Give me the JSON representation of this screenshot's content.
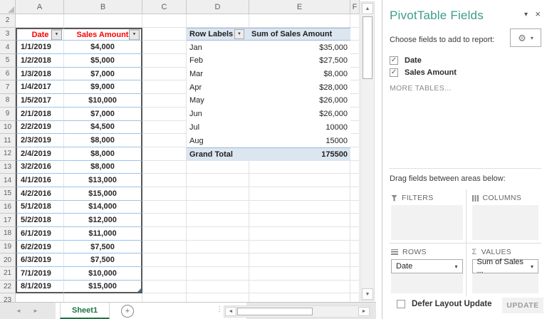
{
  "icons": {
    "chevron_down": "▾",
    "close": "×",
    "gear": "⚙",
    "filter_dropdown": "▼",
    "sort_dropdown": "▼",
    "sigma": "Σ",
    "nav_left": "◄",
    "nav_right": "►",
    "plus": "+",
    "dots": "⋮",
    "up": "▲",
    "down": "▼",
    "left": "◄",
    "right": "►",
    "check": "✓"
  },
  "colors": {
    "header_text_red": "#FE0000",
    "pivot_shade_blue": "#DCE6F1",
    "table_row_line_blue": "#9DC3E6",
    "sheet_tab_green": "#217346",
    "pane_title_teal": "#3E9B8B"
  },
  "sheet": {
    "tab_name": "Sheet1",
    "columns": [
      "A",
      "B",
      "C",
      "D",
      "E",
      "F"
    ],
    "row_numbers": [
      "2",
      "3",
      "4",
      "5",
      "6",
      "7",
      "8",
      "9",
      "10",
      "11",
      "12",
      "13",
      "14",
      "15",
      "16",
      "17",
      "18",
      "19",
      "20",
      "21",
      "22",
      "23"
    ],
    "table": {
      "headers": [
        "Date",
        "Sales Amount"
      ],
      "rows": [
        [
          "1/1/2019",
          "$4,000"
        ],
        [
          "1/2/2018",
          "$5,000"
        ],
        [
          "1/3/2018",
          "$7,000"
        ],
        [
          "1/4/2017",
          "$9,000"
        ],
        [
          "1/5/2017",
          "$10,000"
        ],
        [
          "2/1/2018",
          "$7,000"
        ],
        [
          "2/2/2019",
          "$4,500"
        ],
        [
          "2/3/2019",
          "$8,000"
        ],
        [
          "2/4/2019",
          "$8,000"
        ],
        [
          "3/2/2016",
          "$8,000"
        ],
        [
          "4/1/2016",
          "$13,000"
        ],
        [
          "4/2/2016",
          "$15,000"
        ],
        [
          "5/1/2018",
          "$14,000"
        ],
        [
          "5/2/2018",
          "$12,000"
        ],
        [
          "6/1/2019",
          "$11,000"
        ],
        [
          "6/2/2019",
          "$7,500"
        ],
        [
          "6/3/2019",
          "$7,500"
        ],
        [
          "7/1/2019",
          "$10,000"
        ],
        [
          "8/1/2019",
          "$15,000"
        ]
      ]
    },
    "pivot": {
      "headers": [
        "Row Labels",
        "Sum of Sales Amount"
      ],
      "rows": [
        [
          "Jan",
          "$35,000"
        ],
        [
          "Feb",
          "$27,500"
        ],
        [
          "Mar",
          "$8,000"
        ],
        [
          "Apr",
          "$28,000"
        ],
        [
          "May",
          "$26,000"
        ],
        [
          "Jun",
          "$26,000"
        ],
        [
          "Jul",
          "10000"
        ],
        [
          "Aug",
          "15000"
        ],
        [
          "Grand Total",
          "175500"
        ]
      ]
    }
  },
  "panel": {
    "title": "PivotTable Fields",
    "choose_label": "Choose fields to add to report:",
    "fields": [
      {
        "label": "Date",
        "checked": true
      },
      {
        "label": "Sales Amount",
        "checked": true
      }
    ],
    "more_tables": "MORE TABLES...",
    "drag_label": "Drag fields between areas below:",
    "areas": {
      "filters": {
        "label": "FILTERS"
      },
      "columns": {
        "label": "COLUMNS"
      },
      "rows": {
        "label": "ROWS",
        "item": "Date"
      },
      "values": {
        "label": "VALUES",
        "item": "Sum of Sales ..."
      }
    },
    "defer_label": "Defer Layout Update",
    "update_label": "UPDATE"
  }
}
